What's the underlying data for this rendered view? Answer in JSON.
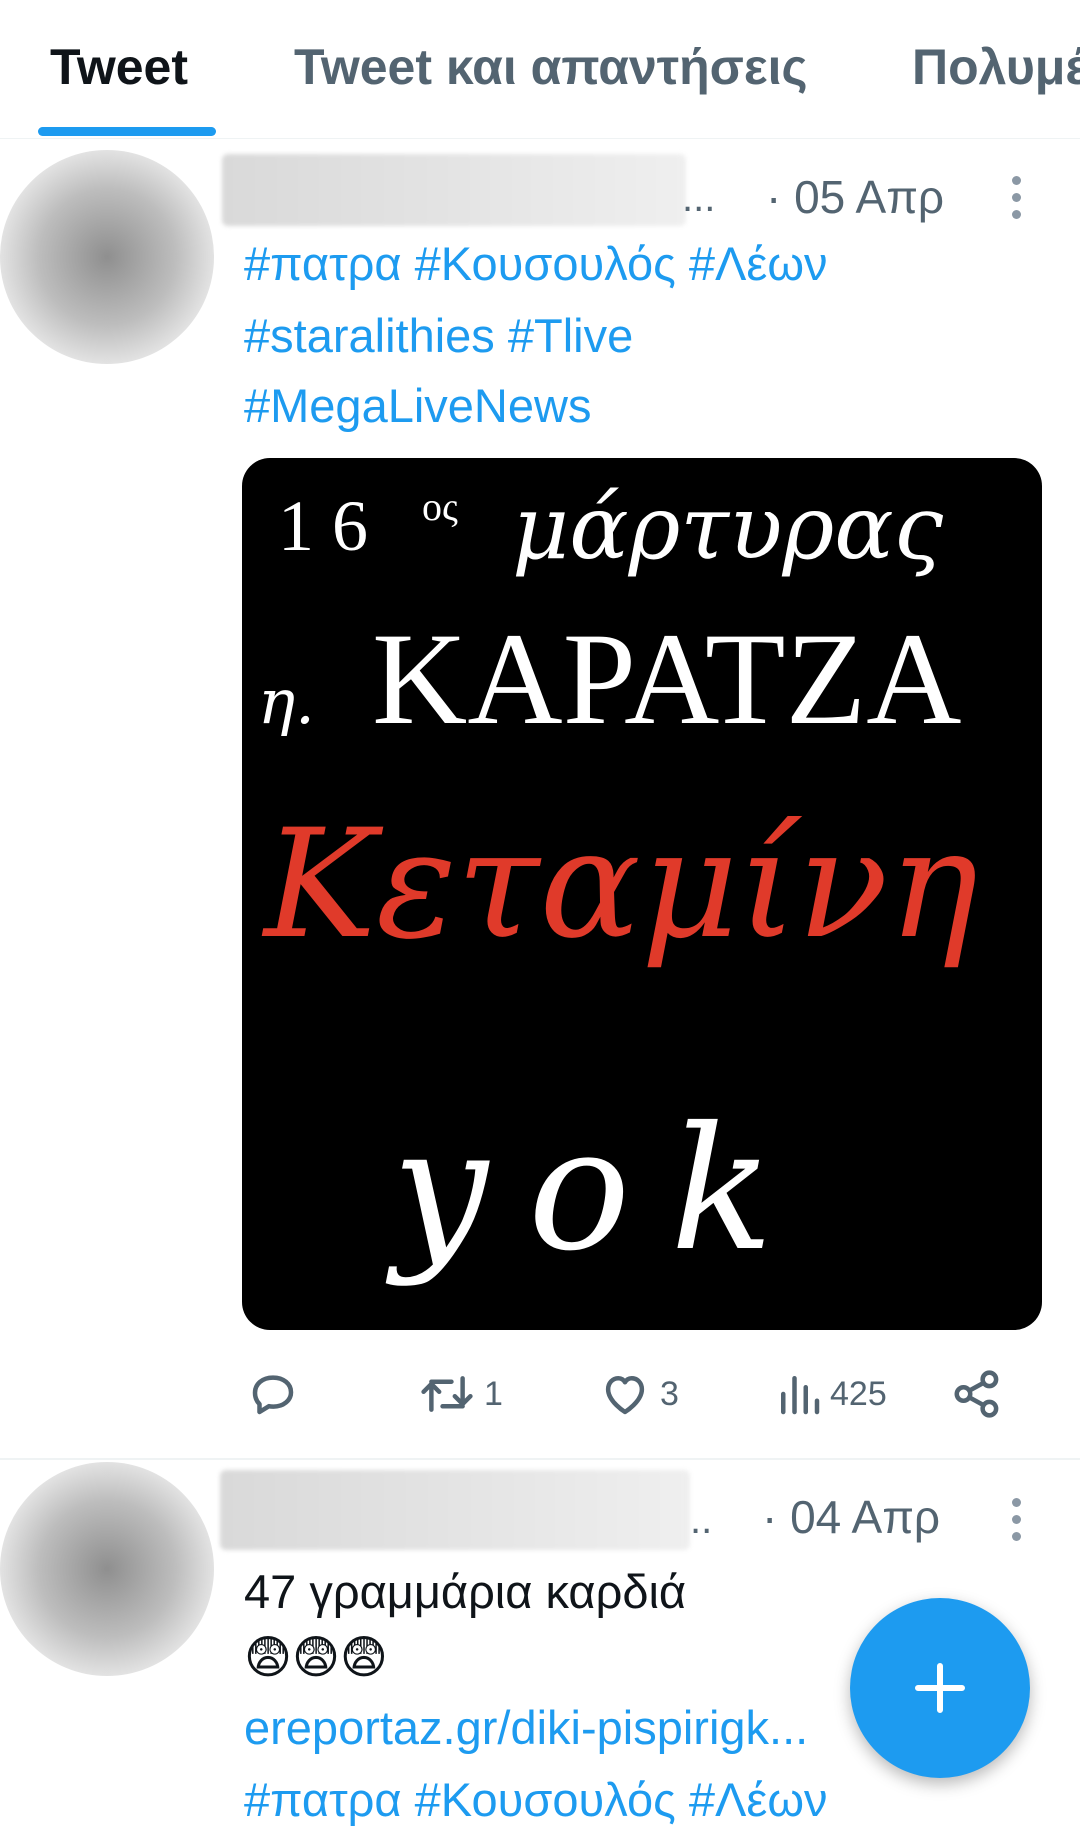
{
  "tabs": [
    {
      "label": "Tweet",
      "active": true
    },
    {
      "label": "Tweet και απαντήσεις",
      "active": false
    },
    {
      "label": "Πολυμέσα",
      "active": false
    }
  ],
  "tweets": [
    {
      "name_suffix": "...",
      "date": "· 05 Απρ",
      "lines": [
        "#πατρα #Κουσουλός #Λέων",
        "#staralithies #Tlive",
        "#MegaLiveNews"
      ],
      "media": {
        "line1_num": "1 6",
        "line1_sup": "ος",
        "line1_word": "μάρτυρας",
        "line2_prefix": "η.",
        "line2_word": "ΚΑΡΑΤΖΑ",
        "line3": "Κεταμίνη",
        "line4": "yok"
      },
      "actions": {
        "reply": "",
        "retweet": "1",
        "like": "3",
        "views": "425"
      }
    },
    {
      "name_suffix": "..",
      "date": "· 04 Απρ",
      "text": "47 γραμμάρια καρδιά",
      "emoji": "😨😨😨",
      "link": "ereportaz.gr/diki-pispirigk...",
      "hashtags": "#πατρα #Κουσουλός #Λέων"
    }
  ],
  "colors": {
    "accent": "#1d9bf0",
    "muted": "#536471",
    "media_red": "#e03a2a"
  },
  "fab": {
    "icon": "plus-icon"
  }
}
